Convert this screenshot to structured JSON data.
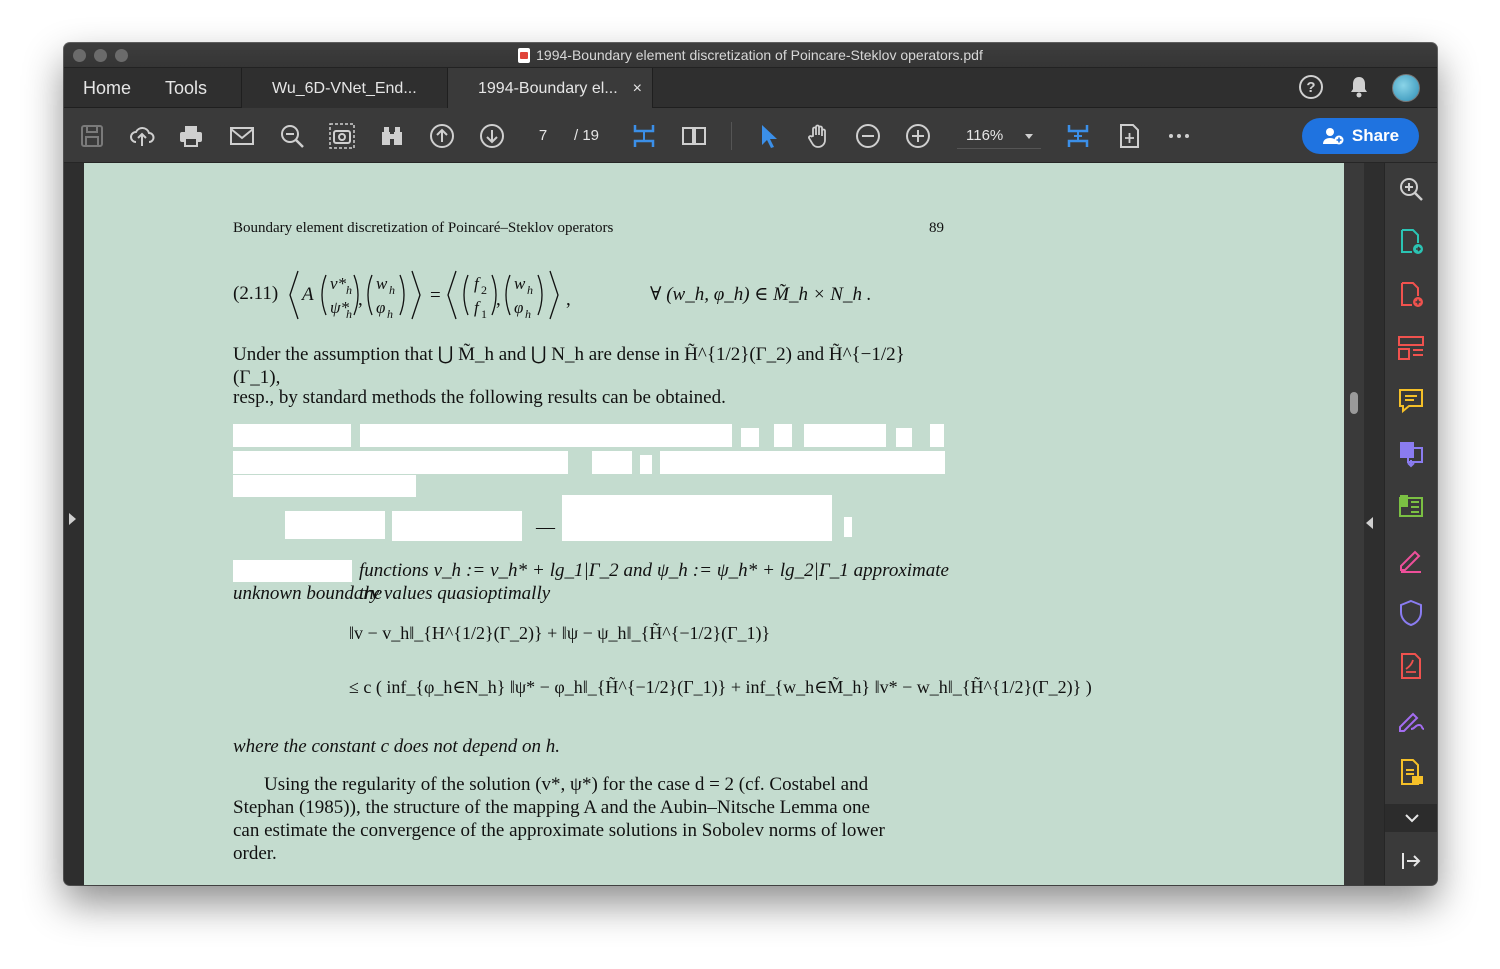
{
  "window": {
    "title": "1994-Boundary element discretization of Poincare-Steklov operators.pdf"
  },
  "tabs": {
    "home": "Home",
    "tools": "Tools",
    "doc1": "Wu_6D-VNet_End...",
    "doc2": "1994-Boundary el...",
    "close": "×"
  },
  "toolbar": {
    "page_current": "7",
    "page_total": "/ 19",
    "zoom": "116%",
    "share_label": "Share",
    "icons": [
      "save-icon",
      "upload-cloud-icon",
      "print-icon",
      "mail-icon",
      "search-icon",
      "snapshot-icon",
      "binoculars-icon",
      "page-up-icon",
      "page-down-icon",
      "fit-width-icon",
      "two-page-icon",
      "select-cursor-icon",
      "hand-icon",
      "zoom-out-icon",
      "zoom-in-icon",
      "scroll-mode-icon",
      "fit-page-icon",
      "more-icon"
    ]
  },
  "right_panel": {
    "icons": [
      "zoom-search-icon",
      "export-pdf-icon",
      "create-pdf-icon",
      "organize-pages-icon",
      "comment-icon",
      "combine-files-icon",
      "edit-pdf-icon",
      "fill-sign-icon",
      "protect-icon",
      "compress-pdf-icon",
      "request-signature-icon",
      "send-review-icon",
      "expand-icon",
      "collapse-panel-icon"
    ]
  },
  "page": {
    "running_head": "Boundary element discretization of Poincaré–Steklov operators",
    "page_number": "89",
    "eq_label": "(2.11)",
    "eq_211_rhs": "∀ (w_h, φ_h) ∈ M̃_h × N_h .",
    "para1_line1": "Under the assumption that ⋃ M̃_h and ⋃ N_h are dense in H̃^{1/2}(Γ_2) and H̃^{−1/2}(Γ_1),",
    "para1_line2": "resp., by standard methods the following results can be obtained.",
    "para2_line1": "functions v_h := v_h* + lg_1|Γ_2 and ψ_h := ψ_h* + lg_2|Γ_1 approximate the",
    "para2_line2": "unknown boundary values quasioptimally",
    "ineq_line1": "‖v − v_h‖_{H^{1/2}(Γ_2)} + ‖ψ − ψ_h‖_{H̃^{−1/2}(Γ_1)}",
    "ineq_line2": "≤ c ( inf_{φ_h∈N_h} ‖ψ* − φ_h‖_{H̃^{−1/2}(Γ_1)} + inf_{w_h∈M̃_h} ‖v* − w_h‖_{H̃^{1/2}(Γ_2)} )",
    "where_line": "where the constant c does not depend on h.",
    "para3": [
      "Using the regularity of the solution (v*, ψ*) for the case d = 2 (cf. Costabel and",
      "Stephan (1985)), the structure of the mapping A and the Aubin–Nitsche Lemma one",
      "can estimate the convergence of the approximate solutions in Sobolev norms of lower",
      "order."
    ]
  }
}
